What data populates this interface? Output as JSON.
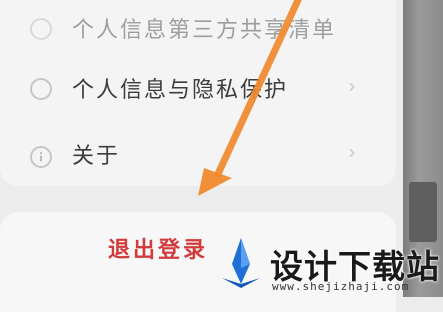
{
  "menu": {
    "items": [
      {
        "label": "个人信息第三方共享清单",
        "icon": "share-list-icon"
      },
      {
        "label": "个人信息与隐私保护",
        "icon": "privacy-shield-icon"
      },
      {
        "label": "关于",
        "icon": "info-icon"
      }
    ],
    "chevron": "›"
  },
  "logout": {
    "label": "退出登录"
  },
  "annotation": {
    "arrow_color": "#f08a2e"
  },
  "watermark": {
    "title": "设计下载站",
    "url": "www.shejizhaji.com",
    "logo_color": "#1f6fd6"
  }
}
